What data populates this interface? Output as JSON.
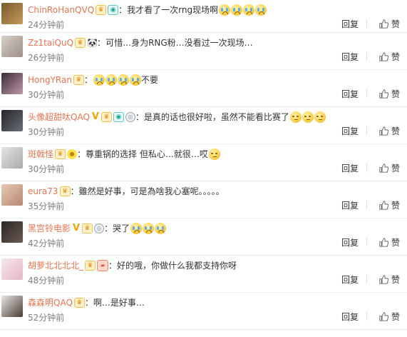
{
  "actions": {
    "reply": "回复",
    "like": "赞"
  },
  "comments": [
    {
      "user": "ChinRoHanQVQ",
      "badges": [
        "crown",
        "eye"
      ],
      "text": "我才看了一次rng现场啊",
      "emojis": 4,
      "dull": false,
      "time": "24分钟前",
      "avatar": [
        "#7a5a2c",
        "#c49a5a"
      ]
    },
    {
      "user": "Zz1taiQuQ",
      "badges": [
        "crown",
        "panda"
      ],
      "text": "可惜…身为RNG粉…没看过一次现场…",
      "emojis": 0,
      "dull": false,
      "time": "26分钟前",
      "avatar": [
        "#d6cfc8",
        "#9c8f86"
      ]
    },
    {
      "user": "HongYRan",
      "badges": [
        "crown"
      ],
      "text": "不要",
      "emojisBefore": 4,
      "emojis": 0,
      "dull": false,
      "time": "30分钟前",
      "avatar": [
        "#3b2a3a",
        "#c09aa7"
      ]
    },
    {
      "user": "头像超甜呔QAQ",
      "badges": [
        "v",
        "crown",
        "eye",
        "medal"
      ],
      "text": "是真的话也很好啦，虽然不能看比赛了",
      "emojis": 3,
      "dull": true,
      "time": "30分钟前",
      "avatar": [
        "#222428",
        "#6b6e74"
      ]
    },
    {
      "user": "斑戟怪",
      "badges": [
        "crown",
        "chick"
      ],
      "text": "尊重锅的选择 但私心…就很…哎",
      "emojis": 1,
      "dull": true,
      "time": "30分钟前",
      "avatar": [
        "#e5e5e5",
        "#a9a9a9"
      ]
    },
    {
      "user": "eura73",
      "badges": [
        "crown"
      ],
      "text": "雖然是好事，可是為啥我心塞呢。。。。。",
      "emojis": 0,
      "dull": false,
      "time": "35分钟前",
      "avatar": [
        "#e7c7b2",
        "#b58a73"
      ]
    },
    {
      "user": "黑宫铃电影",
      "badges": [
        "v",
        "crown",
        "medal"
      ],
      "text": "哭了",
      "emojis": 3,
      "dull": false,
      "time": "42分钟前",
      "avatar": [
        "#2b2523",
        "#6a5a52"
      ]
    },
    {
      "user": "胡萝北北北北_",
      "badges": [
        "crown",
        "card"
      ],
      "text": "好的哦，你做什么我都支持你呀",
      "emojis": 0,
      "dull": false,
      "time": "48分钟前",
      "avatar": [
        "#f4e7ec",
        "#e6b8c7"
      ]
    },
    {
      "user": "森森明QAQ",
      "badges": [
        "crown"
      ],
      "text": "啊…是好事…",
      "emojis": 0,
      "dull": false,
      "time": "52分钟前",
      "avatar": [
        "#e9e6e3",
        "#4a3c36"
      ]
    }
  ]
}
